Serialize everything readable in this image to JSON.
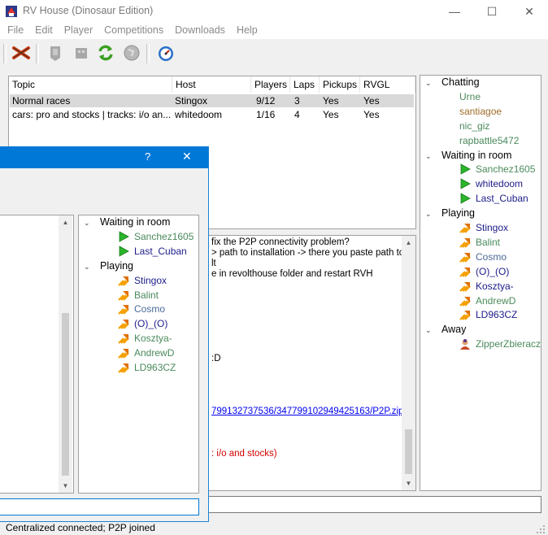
{
  "window": {
    "title": "RV House (Dinosaur Edition)",
    "controls": [
      "—",
      "☐",
      "✕"
    ]
  },
  "menu": [
    "File",
    "Edit",
    "Player",
    "Competitions",
    "Downloads",
    "Help"
  ],
  "toolbar": {
    "icons": [
      "disconnect-icon",
      "host-icon",
      "join-icon",
      "refresh-icon",
      "globe-icon",
      "speedometer-icon"
    ]
  },
  "rooms": {
    "columns": [
      "Topic",
      "Host",
      "Players",
      "Laps",
      "Pickups",
      "RVGL"
    ],
    "rows": [
      {
        "topic": "Normal races",
        "host": "Stingox",
        "players": "9/12",
        "laps": "3",
        "pickups": "Yes",
        "rvgl": "Yes",
        "selected": true
      },
      {
        "topic": "cars: pro and stocks | tracks: i/o an...",
        "host": "whitedoom",
        "players": "1/16",
        "laps": "4",
        "pickups": "Yes",
        "rvgl": "Yes",
        "selected": false
      }
    ]
  },
  "users": {
    "groups": [
      {
        "label": "Chatting",
        "icon": "none",
        "members": [
          {
            "name": "Urne",
            "color": "#4a8a5c"
          },
          {
            "name": "santiagoe",
            "color": "#a06a28"
          },
          {
            "name": "nic_giz",
            "color": "#4a8a5c"
          },
          {
            "name": "rapbattle5472",
            "color": "#4a8a5c"
          }
        ]
      },
      {
        "label": "Waiting in room",
        "icon": "flag",
        "members": [
          {
            "name": "Sanchez1605",
            "color": "#4a8a5c"
          },
          {
            "name": "whitedoom",
            "color": "#1c1c8a"
          },
          {
            "name": "Last_Cuban",
            "color": "#1c1c8a"
          }
        ]
      },
      {
        "label": "Playing",
        "icon": "racing",
        "members": [
          {
            "name": "Stingox",
            "color": "#1c1c8a"
          },
          {
            "name": "Balint",
            "color": "#4a8a5c"
          },
          {
            "name": "Cosmo",
            "color": "#4a6a9a"
          },
          {
            "name": "(O)_(O)",
            "color": "#1c1c8a"
          },
          {
            "name": "Kosztya-",
            "color": "#1c1c8a"
          },
          {
            "name": "AndrewD",
            "color": "#4a8a5c"
          },
          {
            "name": "LD963CZ",
            "color": "#1c1c8a"
          }
        ]
      },
      {
        "label": "Away",
        "icon": "away",
        "members": [
          {
            "name": "ZipperZbieracz",
            "color": "#4a8a5c"
          }
        ]
      }
    ]
  },
  "chat": {
    "lines": [
      {
        "text": "fix the P2P connectivity problem?",
        "color": "#000000",
        "link": false
      },
      {
        "text": "> path to installation -> there you paste path to",
        "color": "#000000",
        "link": false
      },
      {
        "text": "lt",
        "color": "#000000",
        "link": false
      },
      {
        "text": "e in revolthouse folder and restart RVH",
        "color": "#000000",
        "link": false
      },
      {
        "text": ":D",
        "color": "#000000",
        "link": false
      },
      {
        "text": "799132737536/347799102949425163/P2P.zip",
        "color": "#0000ee",
        "link": true
      },
      {
        "text": ": i/o and stocks)",
        "color": "#d40000",
        "link": false
      }
    ]
  },
  "dialog": {
    "help": "?",
    "close": "✕",
    "groups": [
      {
        "label": "Waiting in room",
        "icon": "flag",
        "members": [
          {
            "name": "Sanchez1605",
            "color": "#4a8a5c"
          },
          {
            "name": "Last_Cuban",
            "color": "#1c1c8a"
          }
        ]
      },
      {
        "label": "Playing",
        "icon": "racing",
        "members": [
          {
            "name": "Stingox",
            "color": "#1c1c8a"
          },
          {
            "name": "Balint",
            "color": "#4a8a5c"
          },
          {
            "name": "Cosmo",
            "color": "#4a6a9a"
          },
          {
            "name": "(O)_(O)",
            "color": "#1c1c8a"
          },
          {
            "name": "Kosztya-",
            "color": "#4a8a5c"
          },
          {
            "name": "AndrewD",
            "color": "#4a8a5c"
          },
          {
            "name": "LD963CZ",
            "color": "#4a8a5c"
          }
        ]
      }
    ]
  },
  "status": {
    "text": "Centralized connected; P2P joined"
  }
}
